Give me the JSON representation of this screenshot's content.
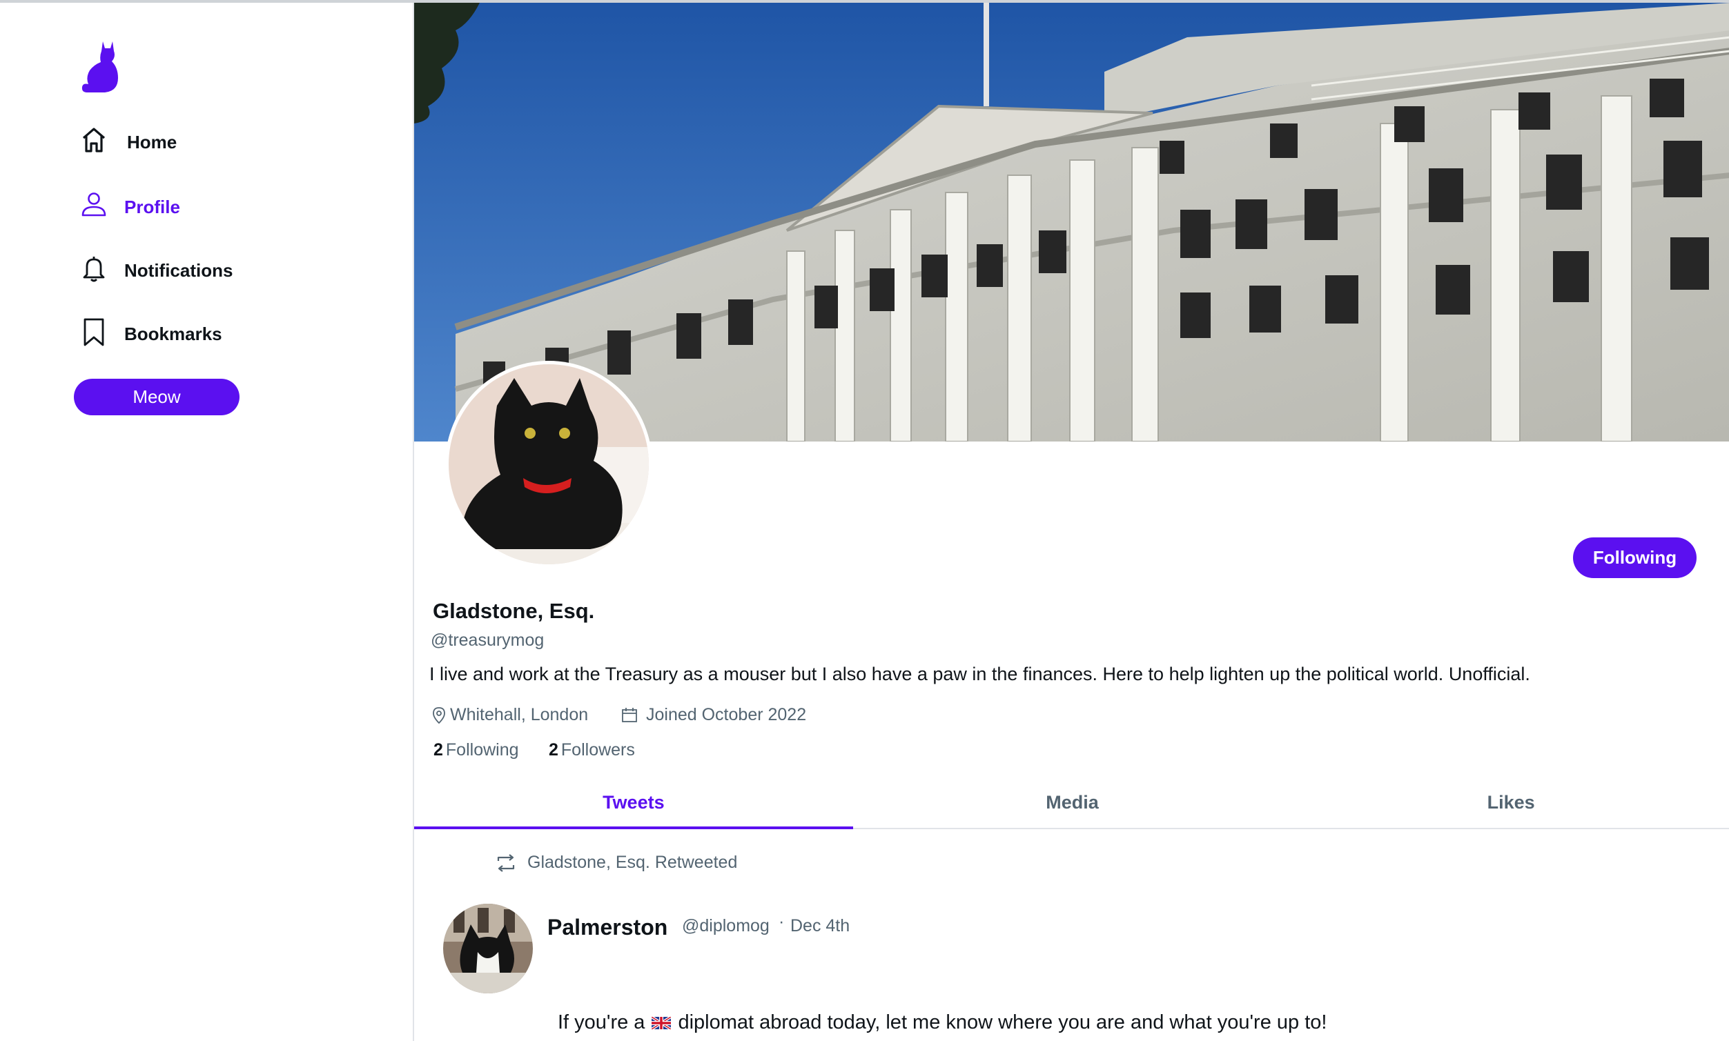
{
  "colors": {
    "accent": "#5b10f0",
    "muted": "#536471",
    "text": "#0f1419"
  },
  "sidebar": {
    "logo_icon": "cat-icon",
    "items": [
      {
        "label": "Home",
        "icon": "home-icon",
        "active": false
      },
      {
        "label": "Profile",
        "icon": "user-icon",
        "active": true
      },
      {
        "label": "Notifications",
        "icon": "bell-icon",
        "active": false
      },
      {
        "label": "Bookmarks",
        "icon": "bookmark-icon",
        "active": false
      }
    ],
    "post_button_label": "Meow"
  },
  "profile": {
    "name": "Gladstone, Esq.",
    "handle": "@treasurymog",
    "bio": "I live and work at the Treasury as a mouser but I also have a paw in the finances. Here to help lighten up the political world. Unofficial.",
    "location": "Whitehall, London",
    "joined": "Joined October 2022",
    "following_count": "2",
    "following_label": "Following",
    "followers_count": "2",
    "followers_label": "Followers",
    "follow_button_label": "Following"
  },
  "tabs": [
    {
      "label": "Tweets",
      "active": true
    },
    {
      "label": "Media",
      "active": false
    },
    {
      "label": "Likes",
      "active": false
    }
  ],
  "feed": [
    {
      "retweeted_by": "Gladstone, Esq. Retweeted",
      "author_name": "Palmerston",
      "author_handle": "@diplomog",
      "separator": "·",
      "date": "Dec 4th",
      "text_before_flag": "If you're a",
      "flag": "uk-flag-icon",
      "text_after_flag": "diplomat abroad today, let me know where you are and what you're up to!"
    }
  ]
}
